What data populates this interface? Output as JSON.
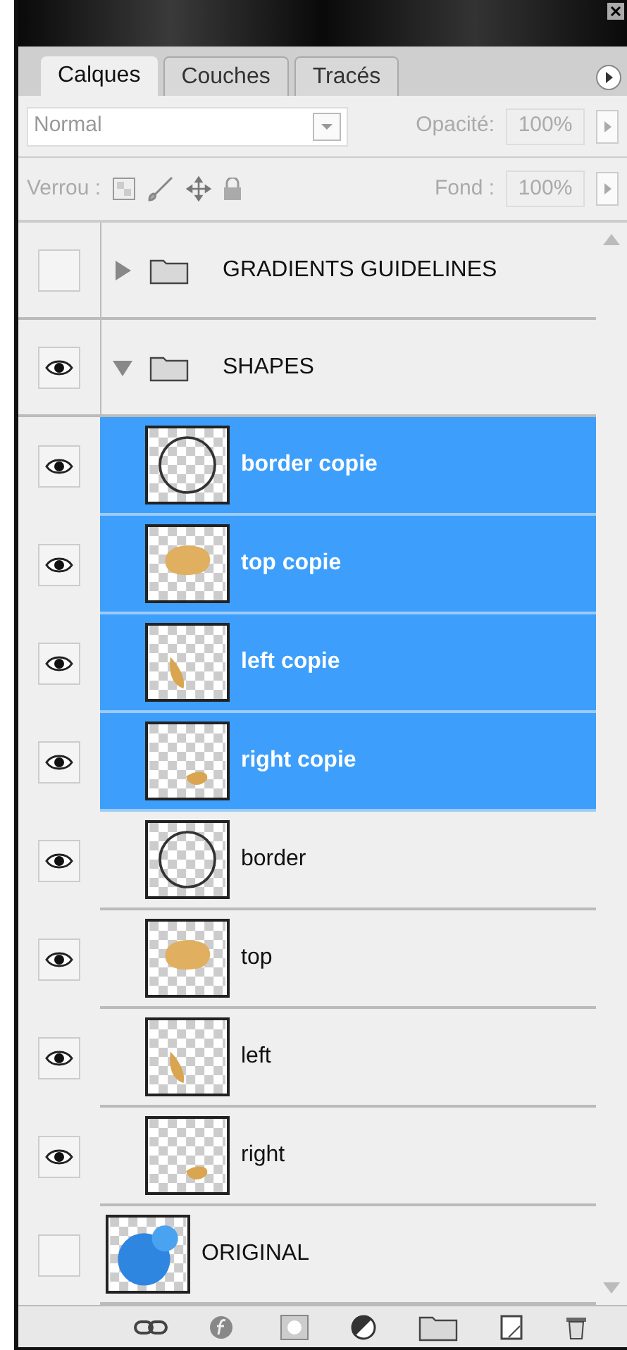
{
  "tabs": [
    {
      "label": "Calques",
      "selected": true
    },
    {
      "label": "Couches",
      "selected": false
    },
    {
      "label": "Tracés",
      "selected": false
    }
  ],
  "blend_mode": {
    "value": "Normal"
  },
  "opacity": {
    "label": "Opacité:",
    "value": "100%"
  },
  "lock": {
    "label": "Verrou :"
  },
  "fill": {
    "label": "Fond :",
    "value": "100%"
  },
  "layers": [
    {
      "kind": "group",
      "name": "GRADIENTS GUIDELINES",
      "visible": false,
      "expanded": false
    },
    {
      "kind": "group",
      "name": "SHAPES",
      "visible": true,
      "expanded": true,
      "children": [
        {
          "kind": "ring",
          "name": "border copie",
          "visible": true,
          "selected": true
        },
        {
          "kind": "top",
          "name": "top copie",
          "visible": true,
          "selected": true
        },
        {
          "kind": "left",
          "name": "left copie",
          "visible": true,
          "selected": true
        },
        {
          "kind": "right",
          "name": "right copie",
          "visible": true,
          "selected": true
        },
        {
          "kind": "ring",
          "name": "border",
          "visible": true,
          "selected": false
        },
        {
          "kind": "top",
          "name": "top",
          "visible": true,
          "selected": false
        },
        {
          "kind": "left",
          "name": "left",
          "visible": true,
          "selected": false
        },
        {
          "kind": "right",
          "name": "right",
          "visible": true,
          "selected": false
        }
      ]
    },
    {
      "kind": "sphere",
      "name": "ORIGINAL",
      "visible": false,
      "selected": false
    }
  ]
}
